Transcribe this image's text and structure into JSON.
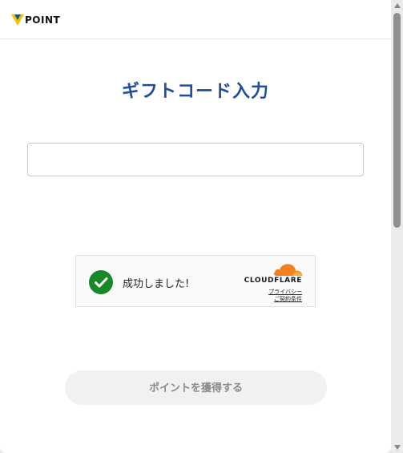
{
  "header": {
    "logo_text": "POINT",
    "logo_icon": "v-logo-icon",
    "brand_colors": {
      "yellow": "#f2c500",
      "blue": "#1f4c9c"
    }
  },
  "main": {
    "title": "ギフトコード入力",
    "code_input": {
      "value": "",
      "placeholder": ""
    }
  },
  "captcha": {
    "status_icon": "check-circle-icon",
    "status_text": "成功しました!",
    "provider_logo_icon": "cloudflare-cloud-icon",
    "provider": "CLOUDFLARE",
    "privacy_link": "プライバシー",
    "terms_link": "ご契約条件",
    "success_color": "#178a27",
    "provider_color": "#f38020"
  },
  "submit": {
    "label": "ポイントを獲得する"
  }
}
